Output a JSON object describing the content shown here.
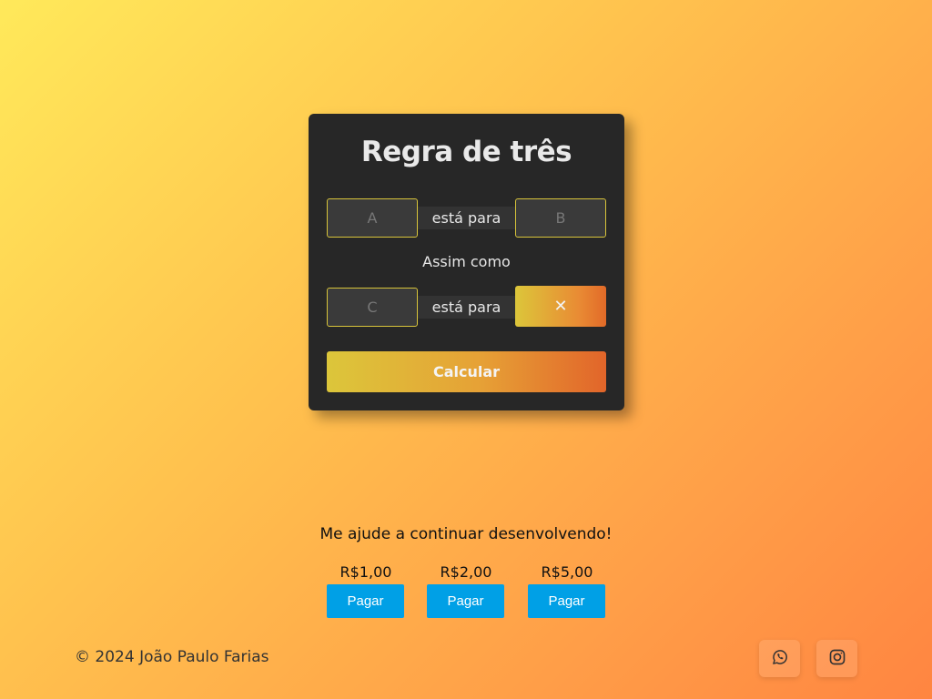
{
  "card": {
    "title": "Regra de três",
    "field_a_placeholder": "A",
    "field_b_placeholder": "B",
    "field_c_placeholder": "C",
    "relation_label": "está para",
    "assim_label": "Assim como",
    "result_symbol": "✕",
    "calculate_label": "Calcular"
  },
  "support": {
    "message": "Me ajude a continuar desenvolvendo!",
    "donations": [
      {
        "amount": "R$1,00",
        "button": "Pagar"
      },
      {
        "amount": "R$2,00",
        "button": "Pagar"
      },
      {
        "amount": "R$5,00",
        "button": "Pagar"
      }
    ]
  },
  "footer": {
    "copyright": "© 2024 João Paulo Farias",
    "social_icons": [
      "whatsapp-icon",
      "instagram-icon"
    ]
  },
  "colors": {
    "card_bg": "#272727",
    "field_border": "#d8c43a",
    "accent_start": "#dcc63a",
    "accent_end": "#e2652a",
    "pay_button": "#00a0e6"
  }
}
